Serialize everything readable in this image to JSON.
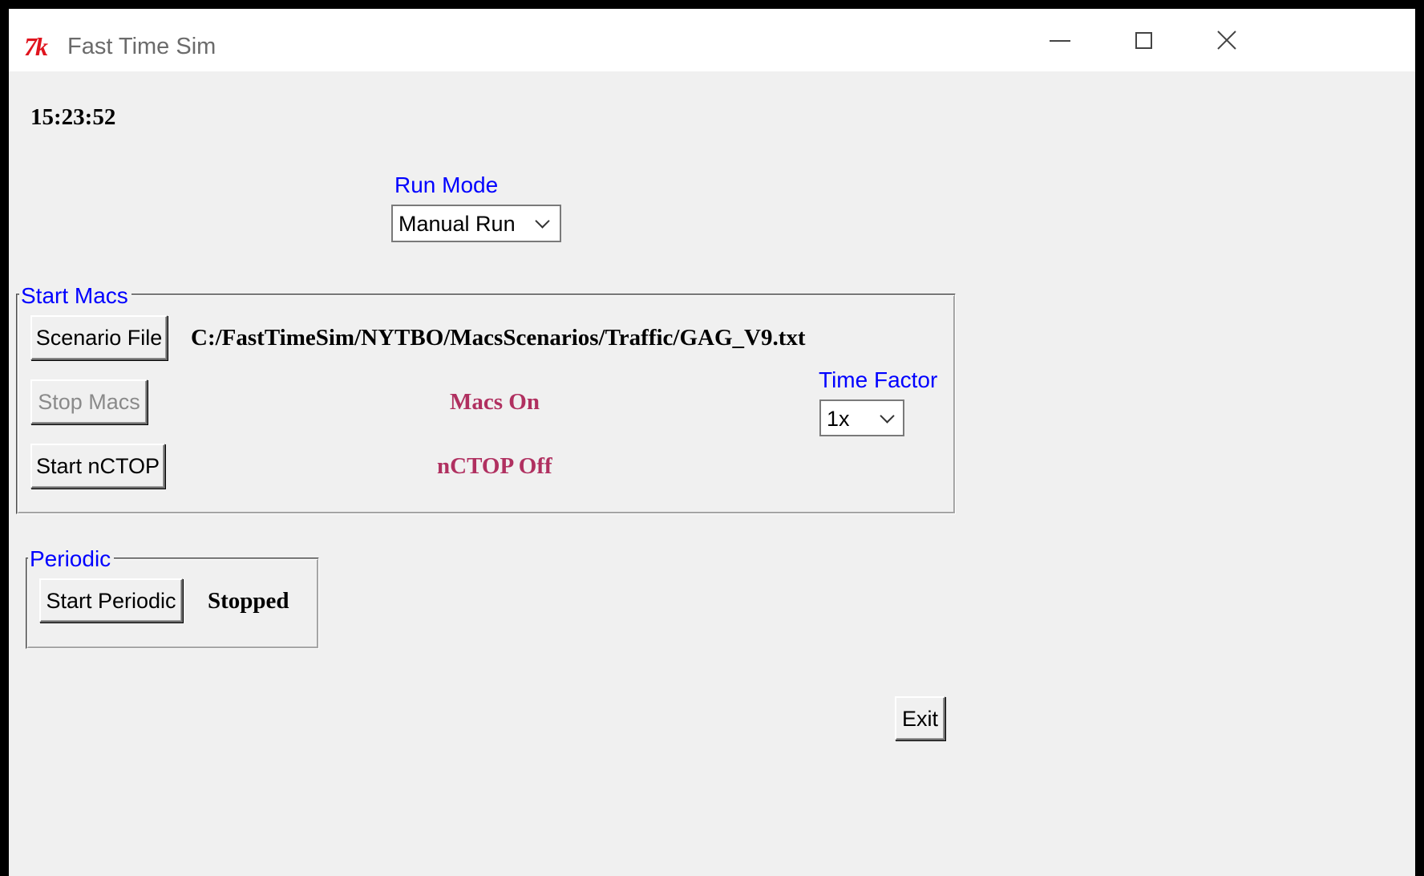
{
  "window": {
    "title": "Fast Time Sim",
    "app_icon_text": "7k",
    "controls": [
      "minimize",
      "maximize",
      "close"
    ]
  },
  "clock": "15:23:52",
  "run_mode": {
    "label": "Run Mode",
    "selected": "Manual Run"
  },
  "start_macs": {
    "title": "Start Macs",
    "scenario_button": "Scenario File",
    "scenario_path": "C:/FastTimeSim/NYTBO/MacsScenarios/Traffic/GAG_V9.txt",
    "stop_macs_button": "Stop Macs",
    "stop_macs_enabled": false,
    "macs_status": "Macs On",
    "start_nctop_button": "Start nCTOP",
    "nctop_status": "nCTOP Off",
    "status_color": "#b03060",
    "time_factor": {
      "label": "Time Factor",
      "selected": "1x"
    }
  },
  "periodic": {
    "title": "Periodic",
    "start_button": "Start Periodic",
    "status": "Stopped"
  },
  "exit_button": "Exit",
  "colors": {
    "label_blue": "#0000ff",
    "window_bg": "#f0f0f0",
    "icon_red": "#e0141e"
  }
}
